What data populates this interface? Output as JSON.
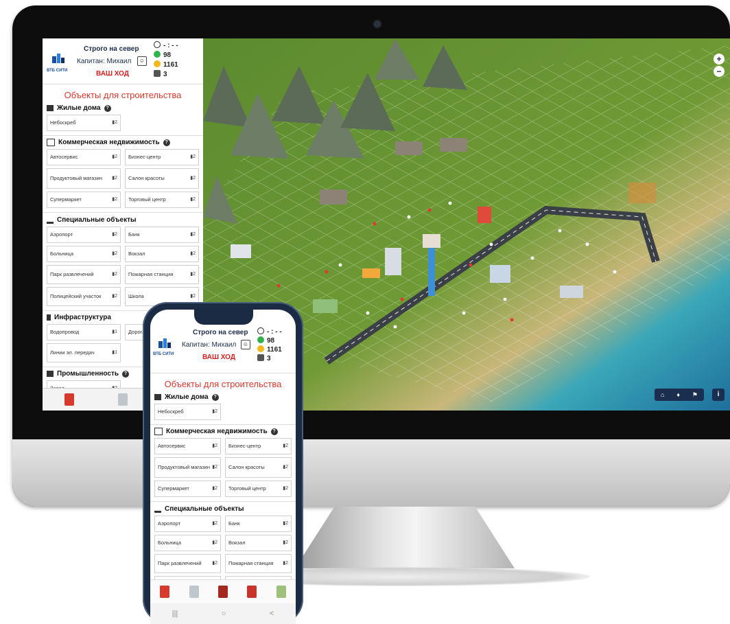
{
  "header": {
    "title": "Строго на север",
    "captain": "Капитан: Михаил",
    "turn": "ВАШ ХОД",
    "logo_text": "ВТБ СИТИ",
    "timer": "- : - -",
    "happiness": "98",
    "stars": "1161",
    "builders": "3"
  },
  "panel": {
    "title": "Объекты для строительства",
    "sections": [
      {
        "name": "Жилые дома",
        "items": [
          {
            "label": "Небоскреб",
            "cost": "2"
          }
        ]
      },
      {
        "name": "Коммерческая недвижимость",
        "items": [
          {
            "label": "Автосервис",
            "cost": "2"
          },
          {
            "label": "Бизнес-центр",
            "cost": "2"
          },
          {
            "label": "Продуктовый магазин",
            "cost": "2"
          },
          {
            "label": "Салон красоты",
            "cost": "2"
          },
          {
            "label": "Супермаркет",
            "cost": "2"
          },
          {
            "label": "Торговый центр",
            "cost": "2"
          }
        ]
      },
      {
        "name": "Специальные объекты",
        "items": [
          {
            "label": "Аэропорт",
            "cost": "2"
          },
          {
            "label": "Банк",
            "cost": "2"
          },
          {
            "label": "Больница",
            "cost": "2"
          },
          {
            "label": "Вокзал",
            "cost": "2"
          },
          {
            "label": "Парк развлечений",
            "cost": "2"
          },
          {
            "label": "Пожарная станция",
            "cost": "2"
          },
          {
            "label": "Полицейский участок",
            "cost": "2"
          },
          {
            "label": "Школа",
            "cost": "2"
          }
        ]
      },
      {
        "name": "Инфраструктура",
        "items": [
          {
            "label": "Водопровод",
            "cost": "1"
          },
          {
            "label": "Дорога",
            "cost": ""
          },
          {
            "label": "Линии эл. передач",
            "cost": "1"
          }
        ]
      },
      {
        "name": "Промышленность",
        "items": [
          {
            "label": "Завод",
            "cost": "2"
          }
        ]
      }
    ]
  },
  "map": {
    "zoom_in": "+",
    "zoom_out": "−",
    "info": "i",
    "toolbar": [
      "⌂",
      "♦",
      "⚑"
    ]
  },
  "phone_nav": [
    "|||",
    "○",
    "<"
  ]
}
